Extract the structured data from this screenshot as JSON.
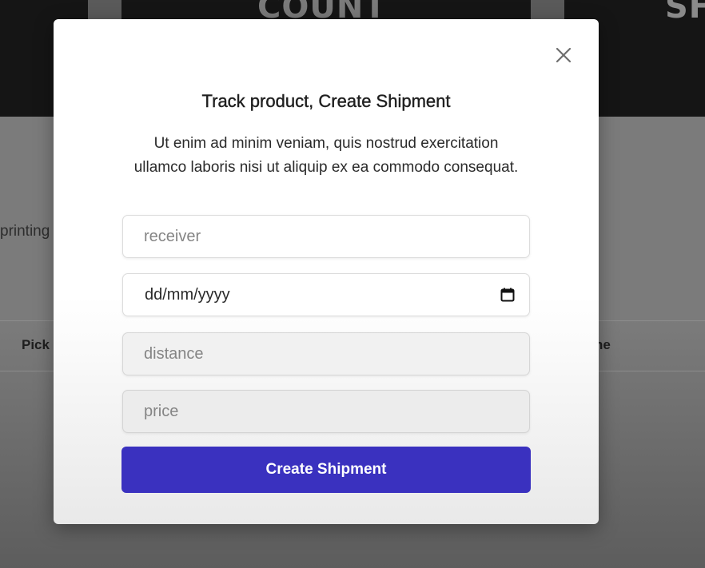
{
  "background": {
    "header_words": [
      "COUNT",
      "SH"
    ],
    "body_text": "printing",
    "table_headers": [
      "Pick",
      "ne"
    ]
  },
  "modal": {
    "title": "Track product, Create Shipment",
    "description": "Ut enim ad minim veniam, quis nostrud exercitation ullamco laboris nisi ut aliquip ex ea commodo consequat.",
    "fields": {
      "receiver_placeholder": "receiver",
      "date_value": "dd/mm/yyyy",
      "distance_placeholder": "distance",
      "price_placeholder": "price"
    },
    "submit_label": "Create Shipment",
    "icons": {
      "close": "close-icon",
      "calendar": "calendar-icon"
    },
    "colors": {
      "button": "#3a31bf",
      "header_bg": "#151515"
    }
  }
}
